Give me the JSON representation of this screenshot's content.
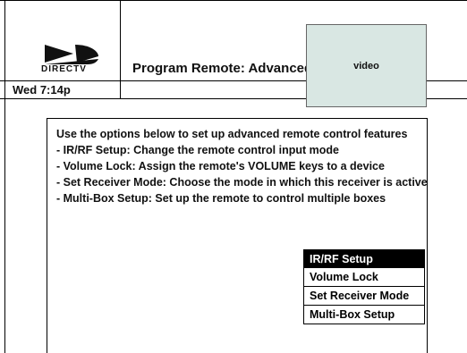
{
  "header": {
    "logo_text": "DIRECTV",
    "title": "Program Remote: Advanced",
    "clock": "Wed 7:14p",
    "video_label": "video"
  },
  "content": {
    "intro": "Use the options below to set up advanced remote control features",
    "descriptions": [
      "- IR/RF Setup: Change the remote control input mode",
      "- Volume Lock: Assign the remote's VOLUME keys to a device",
      "- Set Receiver Mode: Choose the mode in which this receiver is active",
      "- Multi-Box Setup: Set up the remote to control multiple boxes"
    ]
  },
  "menu": {
    "items": [
      {
        "label": "IR/RF Setup"
      },
      {
        "label": "Volume Lock"
      },
      {
        "label": "Set Receiver Mode"
      },
      {
        "label": "Multi-Box Setup"
      }
    ],
    "selected_index": 0
  },
  "colors": {
    "video_bg": "#d9e7e3",
    "selected_bg": "#000000",
    "selected_fg": "#ffffff"
  }
}
